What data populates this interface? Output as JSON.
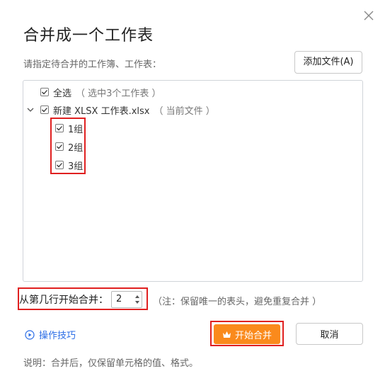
{
  "dialog": {
    "title": "合并成一个工作表",
    "subtitle": "请指定待合并的工作簿、工作表：",
    "add_file_label": "添加文件(A)"
  },
  "tree": {
    "select_all": {
      "label": "全选",
      "note": "（ 选中3个工作表 ）",
      "checked": true
    },
    "workbook": {
      "label": "新建 XLSX 工作表.xlsx",
      "note": "（ 当前文件 ）",
      "checked": true,
      "expanded": true
    },
    "sheets": [
      {
        "label": "1组",
        "checked": true
      },
      {
        "label": "2组",
        "checked": true
      },
      {
        "label": "3组",
        "checked": true
      }
    ]
  },
  "start_row": {
    "label": "从第几行开始合并：",
    "value": "2",
    "note": "（注：保留唯一的表头，避免重复合并 ）"
  },
  "actions": {
    "tips_label": "操作技巧",
    "start_label": "开始合并",
    "cancel_label": "取消"
  },
  "footer": "说明：合并后，仅保留单元格的值、格式。",
  "colors": {
    "accent": "#fa8a1c",
    "link": "#2b6de6",
    "highlight": "#e02020"
  }
}
